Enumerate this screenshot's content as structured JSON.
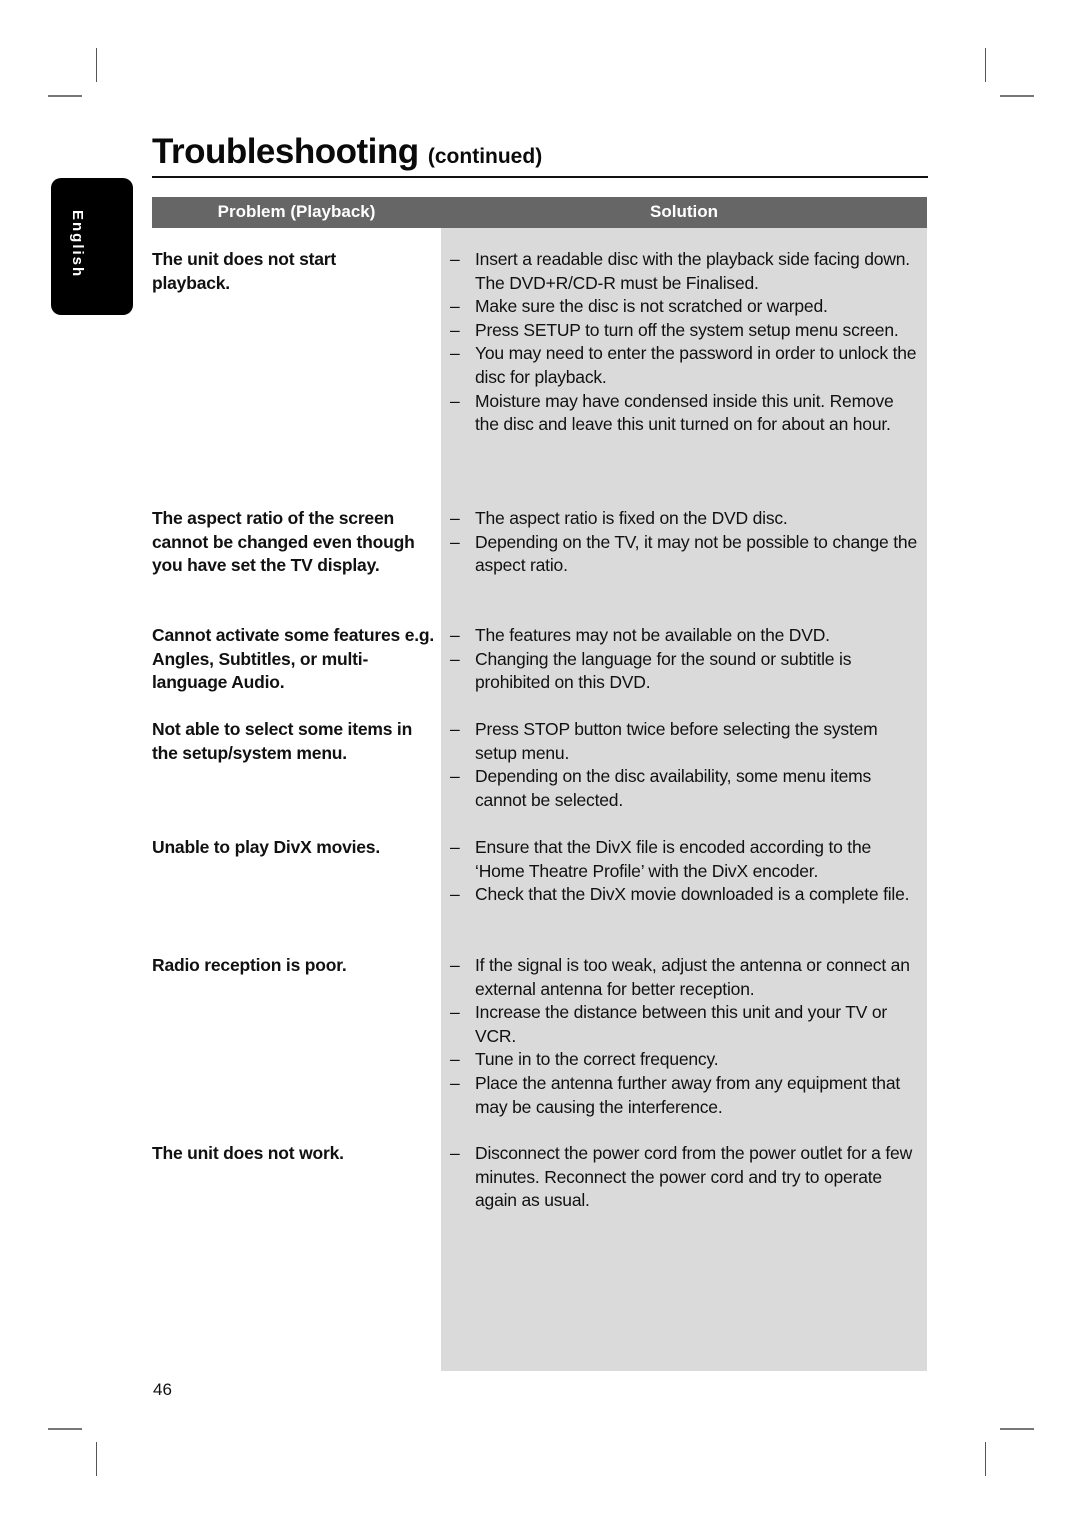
{
  "page": {
    "title": "Troubleshooting",
    "title_suffix": "(continued)",
    "language_tab": "English",
    "page_number": "46"
  },
  "table": {
    "headers": {
      "problem": "Problem (Playback)",
      "solution": "Solution"
    },
    "rows": [
      {
        "problem": "The unit does not start playback.",
        "solutions": [
          "Insert a readable disc with the playback side facing down. The DVD+R/CD-R must be Finalised.",
          "Make sure the disc is not scratched or warped.",
          "Press SETUP to turn off the system setup menu screen.",
          "You may need to enter the password in order to unlock the disc for playback.",
          "Moisture may have condensed inside this unit. Remove the disc and leave this unit turned on for about an hour."
        ]
      },
      {
        "problem": "The aspect ratio of the screen cannot be changed even though you have set the TV display.",
        "solutions": [
          "The aspect ratio is fixed on the DVD disc.",
          "Depending on the TV, it may not be possible to change the aspect ratio."
        ]
      },
      {
        "problem": "Cannot activate some features e.g. Angles, Subtitles, or multi-language Audio.",
        "solutions": [
          "The features may not be available on the DVD.",
          "Changing the language for the sound or subtitle is prohibited on this DVD."
        ]
      },
      {
        "problem": "Not able to select some items in the setup/system menu.",
        "solutions": [
          "Press STOP button twice before selecting the system setup menu.",
          "Depending on the disc availability, some menu items cannot be selected."
        ]
      },
      {
        "problem": "Unable to play DivX movies.",
        "solutions": [
          "Ensure that the DivX file is encoded according to the ‘Home Theatre Profile’ with the DivX encoder.",
          "Check that the DivX movie downloaded is a complete file."
        ]
      },
      {
        "problem": "Radio reception is poor.",
        "solutions": [
          "If the signal is too weak, adjust the antenna or connect an external antenna for better reception.",
          "Increase the distance between this unit and your TV or VCR.",
          "Tune in to the correct frequency.",
          "Place the antenna further away from any equipment that may be causing the interference."
        ]
      },
      {
        "problem": "The unit does not work.",
        "solutions": [
          "Disconnect the power cord from the power outlet for a few minutes. Reconnect the power cord and try to operate again as usual."
        ]
      }
    ]
  }
}
